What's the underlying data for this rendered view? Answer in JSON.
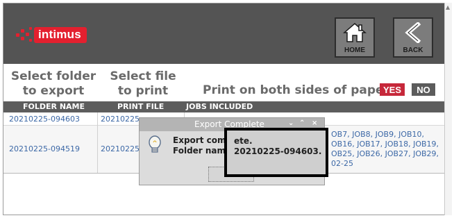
{
  "header": {
    "logo_text": "intimus",
    "home_label": "HOME",
    "back_label": "BACK"
  },
  "columns": {
    "folder_title": "Select folder\nto export",
    "file_title": "Select file\nto print"
  },
  "print_option": {
    "label": "Print on both sides of paper",
    "yes_label": "YES",
    "no_label": "NO",
    "selected": "YES"
  },
  "table": {
    "headers": [
      "FOLDER NAME",
      "PRINT FILE",
      "JOBS INCLUDED"
    ],
    "rows": [
      {
        "folder": "20210225-094603",
        "file": "20210225-",
        "jobs": ""
      },
      {
        "folder": "20210225-094519",
        "file": "20210225-",
        "jobs": "OB7, JOB8, JOB9, JOB10,\nOB16, JOB17, JOB18, JOB19,\nOB25, JOB26, JOB27, JOB29,\n02-25"
      }
    ]
  },
  "dialog": {
    "title": "Export Complete",
    "message": "Export com\nFolder nam",
    "callout_text": "ete.\n20210225-094603."
  },
  "colors": {
    "header_bg": "#545454",
    "brand": "#e3202f",
    "yes_active": "#c6283a",
    "link": "#3c68a6"
  }
}
